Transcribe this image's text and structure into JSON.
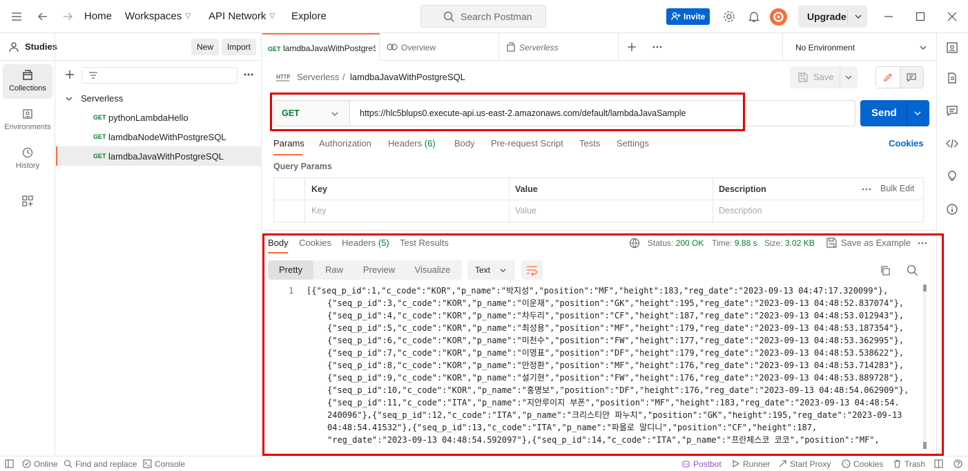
{
  "topbar": {
    "nav": [
      "Home",
      "Workspaces",
      "API Network",
      "Explore"
    ],
    "search_placeholder": "Search Postman",
    "invite_label": "Invite",
    "upgrade_label": "Upgrade"
  },
  "workspace": {
    "title": "Studies",
    "new_label": "New",
    "import_label": "Import"
  },
  "rail": [
    {
      "label": "Collections",
      "icon": "collections-icon"
    },
    {
      "label": "Environments",
      "icon": "environments-icon"
    },
    {
      "label": "History",
      "icon": "history-icon"
    }
  ],
  "collection": {
    "name": "Serverless",
    "requests": [
      {
        "method": "GET",
        "name": "pythonLambdaHello"
      },
      {
        "method": "GET",
        "name": "lamdbaNodeWithPostgreSQL"
      },
      {
        "method": "GET",
        "name": "lamdbaJavaWithPostgreSQL"
      }
    ]
  },
  "tabs": [
    {
      "method": "GET",
      "title": "lamdbaJavaWithPostgreSQL"
    },
    {
      "title": "Overview"
    },
    {
      "title": "Serverless"
    }
  ],
  "environment": "No Environment",
  "request": {
    "breadcrumb_parent": "Serverless",
    "breadcrumb_sep": "/",
    "breadcrumb_current": "lamdbaJavaWithPostgreSQL",
    "save_label": "Save",
    "method": "GET",
    "url": "https://hlc5blups0.execute-api.us-east-2.amazonaws.com/default/lambdaJavaSample",
    "send_label": "Send",
    "tabs": [
      "Params",
      "Authorization",
      "Headers",
      "Body",
      "Pre-request Script",
      "Tests",
      "Settings"
    ],
    "headers_count": "(6)",
    "cookies_label": "Cookies",
    "query_params_title": "Query Params",
    "table": {
      "key_header": "Key",
      "value_header": "Value",
      "desc_header": "Description",
      "bulk_edit": "Bulk Edit",
      "key_placeholder": "Key",
      "value_placeholder": "Value",
      "desc_placeholder": "Description"
    }
  },
  "response": {
    "tabs": [
      "Body",
      "Cookies",
      "Headers",
      "Test Results"
    ],
    "headers_count": "(5)",
    "status_label": "Status:",
    "status_value": "200 OK",
    "time_label": "Time:",
    "time_value": "9.88 s",
    "size_label": "Size:",
    "size_value": "3.02 KB",
    "save_example": "Save as Example",
    "formats": [
      "Pretty",
      "Raw",
      "Preview",
      "Visualize"
    ],
    "language": "Text",
    "line_number": "1",
    "lines": [
      "[{\"seq_p_id\":1,\"c_code\":\"KOR\",\"p_name\":\"박지성\",\"position\":\"MF\",\"height\":183,\"reg_date\":\"2023-09-13 04:47:17.320099\"},",
      "{\"seq_p_id\":3,\"c_code\":\"KOR\",\"p_name\":\"이운재\",\"position\":\"GK\",\"height\":195,\"reg_date\":\"2023-09-13 04:48:52.837074\"},",
      "{\"seq_p_id\":4,\"c_code\":\"KOR\",\"p_name\":\"차두리\",\"position\":\"CF\",\"height\":187,\"reg_date\":\"2023-09-13 04:48:53.012943\"},",
      "{\"seq_p_id\":5,\"c_code\":\"KOR\",\"p_name\":\"최성용\",\"position\":\"MF\",\"height\":179,\"reg_date\":\"2023-09-13 04:48:53.187354\"},",
      "{\"seq_p_id\":6,\"c_code\":\"KOR\",\"p_name\":\"미천수\",\"position\":\"FW\",\"height\":177,\"reg_date\":\"2023-09-13 04:48:53.362995\"},",
      "{\"seq_p_id\":7,\"c_code\":\"KOR\",\"p_name\":\"이영표\",\"position\":\"DF\",\"height\":179,\"reg_date\":\"2023-09-13 04:48:53.538622\"},",
      "{\"seq_p_id\":8,\"c_code\":\"KOR\",\"p_name\":\"안정환\",\"position\":\"MF\",\"height\":176,\"reg_date\":\"2023-09-13 04:48:53.714283\"},",
      "{\"seq_p_id\":9,\"c_code\":\"KOR\",\"p_name\":\"설기현\",\"position\":\"FW\",\"height\":176,\"reg_date\":\"2023-09-13 04:48:53.889728\"},",
      "{\"seq_p_id\":10,\"c_code\":\"KOR\",\"p_name\":\"홍명보\",\"position\":\"DF\",\"height\":176,\"reg_date\":\"2023-09-13 04:48:54.062909\"},",
      "{\"seq_p_id\":11,\"c_code\":\"ITA\",\"p_name\":\"지안루이지 부폰\",\"position\":\"MF\",\"height\":183,\"reg_date\":\"2023-09-13 04:48:54.",
      "240096\"},{\"seq_p_id\":12,\"c_code\":\"ITA\",\"p_name\":\"크리스티안 파누치\",\"position\":\"GK\",\"height\":195,\"reg_date\":\"2023-09-13",
      "04:48:54.41532\"},{\"seq_p_id\":13,\"c_code\":\"ITA\",\"p_name\":\"파올로 말디니\",\"position\":\"CF\",\"height\":187,",
      "\"reg_date\":\"2023-09-13 04:48:54.592097\"},{\"seq_p_id\":14,\"c_code\":\"ITA\",\"p_name\":\"프란체스코 코코\",\"position\":\"MF\","
    ]
  },
  "statusbar": {
    "online": "Online",
    "find_replace": "Find and replace",
    "console": "Console",
    "postbot": "Postbot",
    "runner": "Runner",
    "start_proxy": "Start Proxy",
    "cookies": "Cookies",
    "trash": "Trash"
  },
  "colors": {
    "accent": "#ff6c37",
    "primary_button": "#0265d2",
    "get_method": "#007f31",
    "highlight_border": "#e30000"
  }
}
